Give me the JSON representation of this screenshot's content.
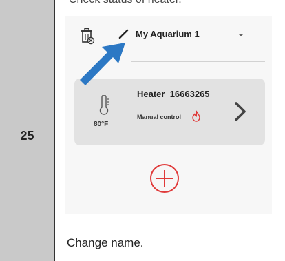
{
  "prev_row_text": "Check status of heater.",
  "step_number": "25",
  "app": {
    "aquarium_name": "My Aquarium 1",
    "device": {
      "temperature": "80°F",
      "name": "Heater_16663265",
      "mode": "Manual control"
    }
  },
  "caption": "Change name.",
  "colors": {
    "accent_red": "#e03a3a",
    "arrow_blue": "#2c78c4",
    "card_bg": "#e2e2e2",
    "step_cell_bg": "#c9c9c9"
  },
  "icons": [
    "trash-icon",
    "pencil-icon",
    "thermometer-icon",
    "flame-icon",
    "chevron-right-icon",
    "add-circle-icon",
    "arrow-pointer-icon"
  ]
}
